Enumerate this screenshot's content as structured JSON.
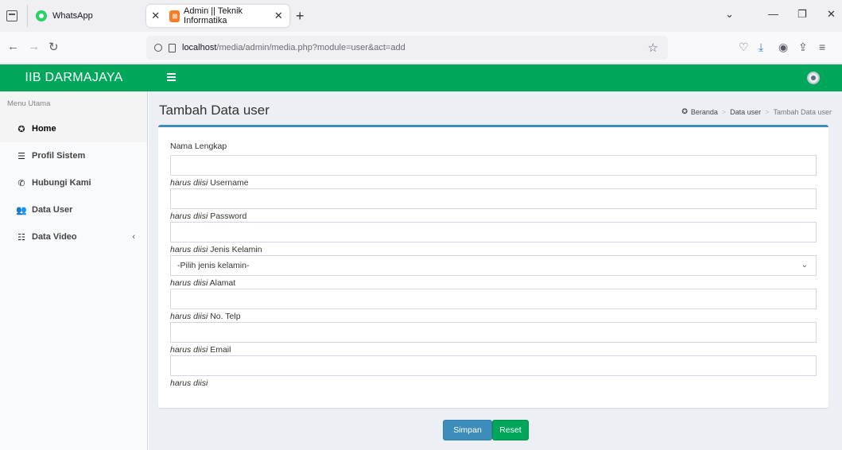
{
  "browser": {
    "tabs": [
      {
        "label": "WhatsApp",
        "icon": "whatsapp-icon"
      },
      {
        "label": "Admin || Teknik Informatika",
        "icon": "xampp-icon",
        "active": true
      }
    ],
    "new_tab_symbol": "+",
    "url_host": "localhost",
    "url_rest": "/media/admin/media.php?module=user&act=add",
    "window_controls": {
      "list": "⌄",
      "minimize": "—",
      "restore": "❐",
      "close": "✕"
    },
    "nav": {
      "back": "←",
      "forward": "→",
      "reload": "↻"
    },
    "toolbar_icons": [
      "pocket-icon",
      "download-icon",
      "account-icon",
      "share-icon",
      "menu-icon"
    ]
  },
  "header": {
    "brand": "IIB DARMAJAYA",
    "brand_color": "#00a65a"
  },
  "sidebar": {
    "section_title": "Menu Utama",
    "items": [
      {
        "label": "Home",
        "icon": "dashboard-icon",
        "glyph": "✪",
        "active": true
      },
      {
        "label": "Profil Sistem",
        "icon": "list-icon",
        "glyph": "☰"
      },
      {
        "label": "Hubungi Kami",
        "icon": "phone-icon",
        "glyph": "✆"
      },
      {
        "label": "Data User",
        "icon": "users-icon",
        "glyph": "👥"
      },
      {
        "label": "Data Video",
        "icon": "database-icon",
        "glyph": "☷",
        "chevron": "‹"
      }
    ]
  },
  "page": {
    "title": "Tambah Data user",
    "breadcrumb": [
      "Beranda",
      "Data user",
      "Tambah Data user"
    ],
    "breadcrumb_sep": ">"
  },
  "form": {
    "required_note": "harus diisi",
    "fields": [
      {
        "label": "Nama Lengkap",
        "type": "text",
        "value": ""
      },
      {
        "label": "Username",
        "type": "text",
        "value": ""
      },
      {
        "label": "Password",
        "type": "password",
        "value": ""
      },
      {
        "label": "Jenis Kelamin",
        "type": "select",
        "value": "-Pilih jenis kelamin-"
      },
      {
        "label": "Alamat",
        "type": "text",
        "value": ""
      },
      {
        "label": "No. Telp",
        "type": "text",
        "value": ""
      },
      {
        "label": "Email",
        "type": "text",
        "value": ""
      }
    ],
    "buttons": {
      "save": "Simpan",
      "reset": "Reset"
    }
  }
}
